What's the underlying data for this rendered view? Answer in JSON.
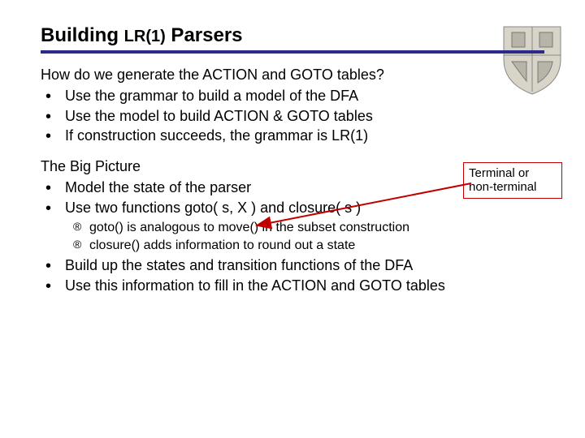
{
  "title": {
    "pre": "Building ",
    "small": "LR(1)",
    "post": " Parsers"
  },
  "section1": {
    "lead": "How do we generate the ACTION and GOTO tables?",
    "bullets": [
      "Use the grammar to build a model of the DFA",
      "Use the model to build ACTION & GOTO tables",
      "If construction succeeds, the grammar is LR(1)"
    ]
  },
  "section2": {
    "lead": "The Big Picture",
    "bullets_top": [
      "Model the state of the parser",
      "Use two functions goto( s, X )  and closure( s )"
    ],
    "sub_bullets": [
      "goto() is analogous to move() in the subset construction",
      "closure() adds information to round out a state"
    ],
    "bullets_bottom": [
      "Build up the states and transition functions of the DFA",
      "Use this information to fill in the ACTION and GOTO tables"
    ]
  },
  "annotation": {
    "line1": "Terminal or",
    "line2": "non-terminal"
  },
  "icons": {
    "crest": "university-crest"
  }
}
